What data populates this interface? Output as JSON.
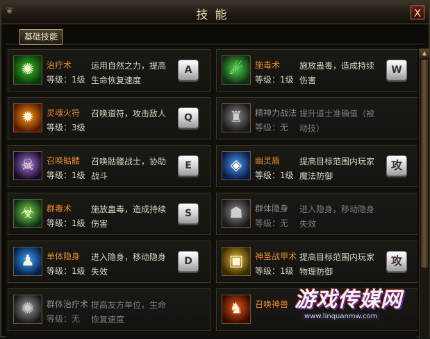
{
  "window": {
    "title": "技能",
    "close_label": "X",
    "corner_ornament": "❦"
  },
  "tabs": [
    {
      "label": "基础技能",
      "active": true
    }
  ],
  "skills": [
    {
      "name": "治疗术",
      "level": "等级：1级",
      "desc": "运用自然之力，提高生命恢复速度",
      "key": "A",
      "icon": "healing-icon",
      "learned": true,
      "colors": [
        "#0a3a0a",
        "#39c227"
      ],
      "glyph": "✺"
    },
    {
      "name": "施毒术",
      "level": "等级：1级",
      "desc": "施放蛊毒，造成持续伤害",
      "key": "W",
      "icon": "poison-icon",
      "learned": true,
      "colors": [
        "#0d3012",
        "#4fd84a"
      ],
      "glyph": "☄"
    },
    {
      "name": "灵魂火符",
      "level": "等级：3级",
      "desc": "召唤道符，攻击敌人",
      "key": "Q",
      "icon": "soul-fire-talisman-icon",
      "learned": true,
      "colors": [
        "#5a1a00",
        "#ff9a1a"
      ],
      "glyph": "✹"
    },
    {
      "name": "精神力战法",
      "level": "等级：无",
      "desc": "提升道士准确值（被动技）",
      "key": "",
      "icon": "spirit-warfare-icon",
      "learned": false,
      "colors": [
        "#1a1a1a",
        "#8a8a8a"
      ],
      "glyph": "♜"
    },
    {
      "name": "召唤骷髅",
      "level": "等级：1级",
      "desc": "召唤骷髅战士，协助战斗",
      "key": "E",
      "icon": "summon-skeleton-icon",
      "learned": true,
      "colors": [
        "#1a0a2a",
        "#a57ad8"
      ],
      "glyph": "☠"
    },
    {
      "name": "幽灵盾",
      "level": "等级：1级",
      "desc": "提高目标范围内玩家魔法防御",
      "key": "攻",
      "icon": "ghost-shield-icon",
      "learned": true,
      "colors": [
        "#0a1c4a",
        "#4a9af2"
      ],
      "glyph": "◈"
    },
    {
      "name": "群毒术",
      "level": "等级：1级",
      "desc": "施放蛊毒，造成持续伤害",
      "key": "S",
      "icon": "mass-poison-icon",
      "learned": true,
      "colors": [
        "#0d3012",
        "#7ad84a"
      ],
      "glyph": "☣"
    },
    {
      "name": "群体隐身",
      "level": "等级：无",
      "desc": "进入隐身，移动隐身失效",
      "key": "",
      "icon": "mass-stealth-icon",
      "learned": false,
      "colors": [
        "#1a1a1a",
        "#909090"
      ],
      "glyph": "☗"
    },
    {
      "name": "单体隐身",
      "level": "等级：1级",
      "desc": "进入隐身，移动隐身失效",
      "key": "D",
      "icon": "stealth-icon",
      "learned": true,
      "colors": [
        "#06204a",
        "#3aa6ff"
      ],
      "glyph": "♟"
    },
    {
      "name": "神圣战甲术",
      "level": "等级：1级",
      "desc": "提高目标范围内玩家物理防御",
      "key": "攻",
      "icon": "holy-armor-icon",
      "learned": true,
      "colors": [
        "#3a2a00",
        "#e8c23a"
      ],
      "glyph": "▣"
    },
    {
      "name": "群体治疗术",
      "level": "等级：无",
      "desc": "提高友方单位，生命恢复速度",
      "key": "",
      "icon": "mass-healing-icon",
      "learned": false,
      "colors": [
        "#1a1a1a",
        "#9a9a9a"
      ],
      "glyph": "✺"
    },
    {
      "name": "召唤神兽",
      "level": "",
      "desc": "",
      "key": "",
      "icon": "summon-beast-icon",
      "learned": true,
      "colors": [
        "#3a0a00",
        "#e85a1a"
      ],
      "glyph": "♞"
    }
  ],
  "watermark": {
    "text": "游戏传媒网",
    "url": "www.linquanmw.com"
  }
}
